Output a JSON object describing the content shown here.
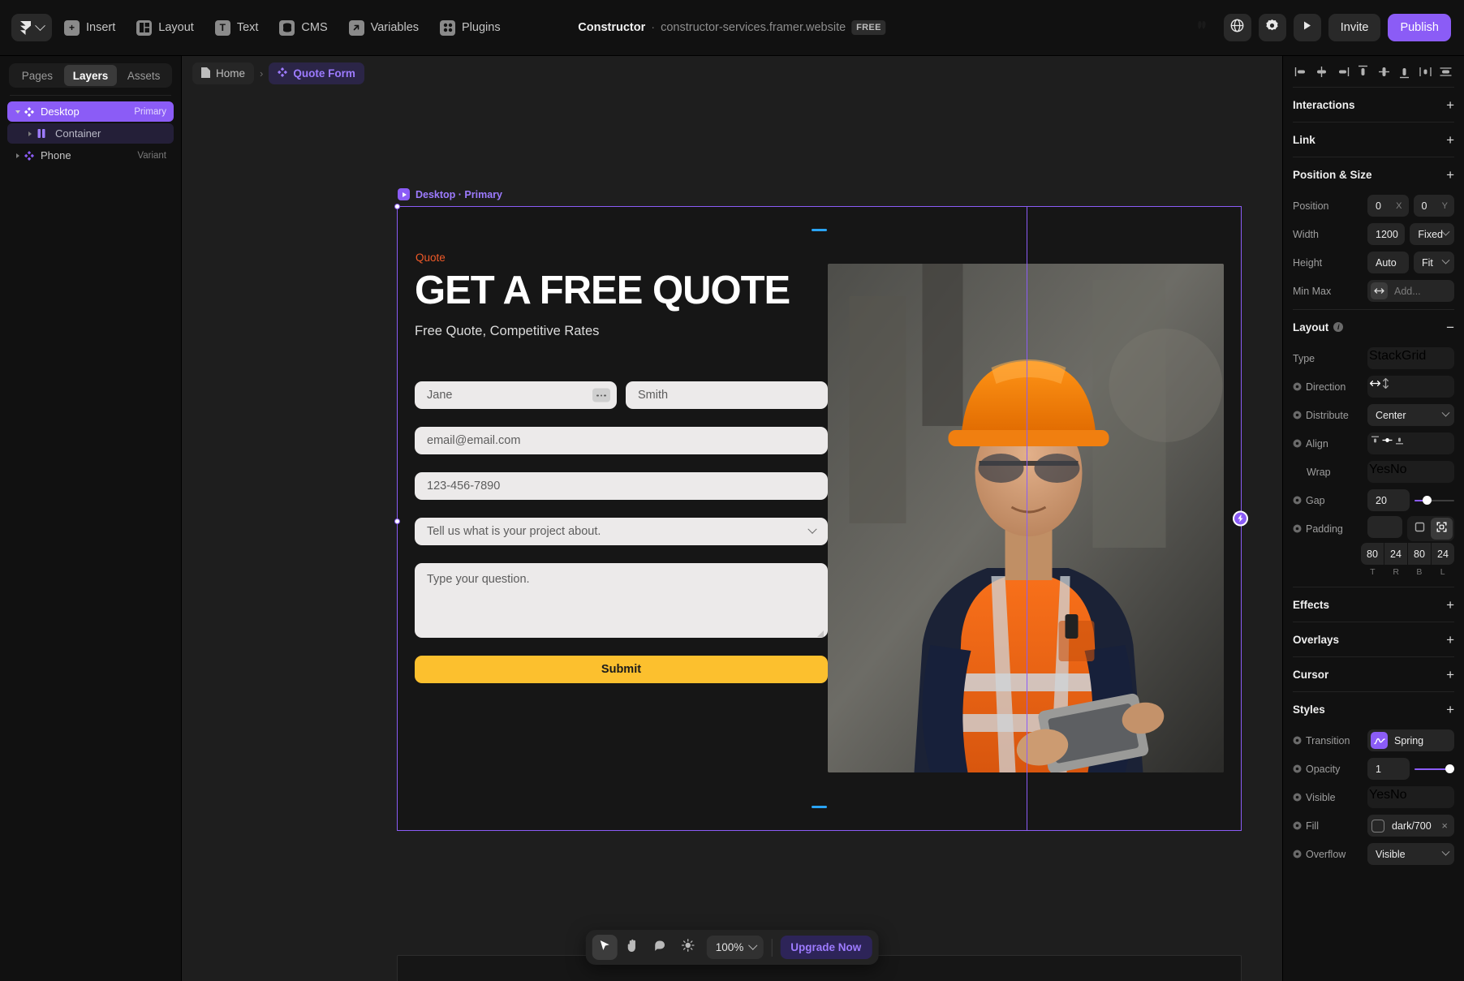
{
  "topbar": {
    "logo_icon": "framer-logo-icon",
    "menus": [
      {
        "label": "Insert",
        "icon": "plus-square-icon"
      },
      {
        "label": "Layout",
        "icon": "layout-columns-icon"
      },
      {
        "label": "Text",
        "icon": "text-t-icon"
      },
      {
        "label": "CMS",
        "icon": "database-icon"
      },
      {
        "label": "Variables",
        "icon": "arrow-up-right-icon"
      },
      {
        "label": "Plugins",
        "icon": "plugins-grid-icon"
      }
    ],
    "project_name": "Constructor",
    "separator": "·",
    "project_url": "constructor-services.framer.website",
    "plan_badge": "FREE",
    "globe_icon": "globe-icon",
    "settings_icon": "gear-dot-icon",
    "preview_icon": "play-icon",
    "invite_label": "Invite",
    "publish_label": "Publish",
    "publish_color": "#8b5cf6"
  },
  "left_panel": {
    "tabs": [
      {
        "label": "Pages",
        "active": false
      },
      {
        "label": "Layers",
        "active": true
      },
      {
        "label": "Assets",
        "active": false
      }
    ],
    "layers": [
      {
        "name": "Desktop",
        "tag": "Primary",
        "state": "selected",
        "icon": "component-diamond-icon"
      },
      {
        "name": "Container",
        "tag": "",
        "state": "child",
        "icon": "stack-columns-icon"
      },
      {
        "name": "Phone",
        "tag": "Variant",
        "state": "plain",
        "icon": "component-diamond-icon"
      }
    ]
  },
  "breadcrumb": {
    "home_label": "Home",
    "home_icon": "page-icon",
    "separator": "›",
    "current_label": "Quote Form",
    "current_icon": "component-diamond-icon"
  },
  "canvas": {
    "artboard_label": "Desktop · Primary",
    "form": {
      "eyebrow": "Quote",
      "eyebrow_color": "#f05a28",
      "headline": "GET A FREE QUOTE",
      "subhead": "Free Quote, Competitive Rates",
      "first_name": "Jane",
      "last_name": "Smith",
      "email": "email@email.com",
      "phone": "123-456-7890",
      "project_select": "Tell us what is your project about.",
      "question": "Type your question.",
      "submit_label": "Submit",
      "submit_color": "#fcc02e"
    },
    "image_alt": "construction-worker-photo"
  },
  "bottombar": {
    "tools": [
      {
        "name": "select-tool",
        "icon": "cursor-arrow-icon",
        "active": true
      },
      {
        "name": "hand-tool",
        "icon": "hand-icon",
        "active": false
      },
      {
        "name": "comment-tool",
        "icon": "comment-bubble-icon",
        "active": false
      },
      {
        "name": "theme-tool",
        "icon": "sun-icon",
        "active": false
      }
    ],
    "zoom_level": "100%",
    "upgrade_label": "Upgrade Now"
  },
  "right_panel": {
    "align_icons": [
      "align-left-icon",
      "align-horizontal-center-icon",
      "align-right-icon",
      "align-top-icon",
      "align-vertical-center-icon",
      "align-bottom-icon",
      "distribute-horizontal-icon",
      "distribute-vertical-icon"
    ],
    "sections": {
      "interactions": {
        "title": "Interactions",
        "action": "+"
      },
      "link": {
        "title": "Link",
        "action": "+"
      },
      "position_size": {
        "title": "Position & Size",
        "action": "+",
        "position_label": "Position",
        "position_x": "0",
        "position_x_unit": "X",
        "position_y": "0",
        "position_y_unit": "Y",
        "width_label": "Width",
        "width_value": "1200",
        "width_mode": "Fixed",
        "height_label": "Height",
        "height_value": "Auto",
        "height_mode": "Fit",
        "minmax_label": "Min Max",
        "minmax_placeholder": "Add...",
        "minmax_icon": "arrows-horizontal-icon"
      },
      "layout": {
        "title": "Layout",
        "action": "−",
        "info_icon": "info-icon",
        "type_label": "Type",
        "type_options": [
          "Stack",
          "Grid"
        ],
        "type_selected": "Stack",
        "direction_label": "Direction",
        "direction_options": [
          "horizontal-arrows-icon",
          "vertical-arrows-icon"
        ],
        "direction_selected": 0,
        "distribute_label": "Distribute",
        "distribute_value": "Center",
        "align_label": "Align",
        "align_options": [
          "align-start-icon",
          "align-center-icon",
          "align-end-icon"
        ],
        "align_selected": 1,
        "wrap_label": "Wrap",
        "wrap_options": [
          "Yes",
          "No"
        ],
        "wrap_selected": "No",
        "gap_label": "Gap",
        "gap_value": "20",
        "padding_label": "Padding",
        "padding_value": "",
        "padding_modes": [
          "all-sides-icon",
          "per-side-icon"
        ],
        "padding_mode_selected": 1,
        "padding_values": [
          "80",
          "24",
          "80",
          "24"
        ],
        "padding_labels": [
          "T",
          "R",
          "B",
          "L"
        ]
      },
      "effects": {
        "title": "Effects",
        "action": "+"
      },
      "overlays": {
        "title": "Overlays",
        "action": "+"
      },
      "cursor": {
        "title": "Cursor",
        "action": "+"
      },
      "styles": {
        "title": "Styles",
        "action": "+",
        "transition_label": "Transition",
        "transition_value": "Spring",
        "transition_icon": "spring-curve-icon",
        "opacity_label": "Opacity",
        "opacity_value": "1",
        "visible_label": "Visible",
        "visible_options": [
          "Yes",
          "No"
        ],
        "visible_selected": "Yes",
        "fill_label": "Fill",
        "fill_value": "dark/700",
        "overflow_label": "Overflow",
        "overflow_value": "Visible"
      }
    }
  }
}
